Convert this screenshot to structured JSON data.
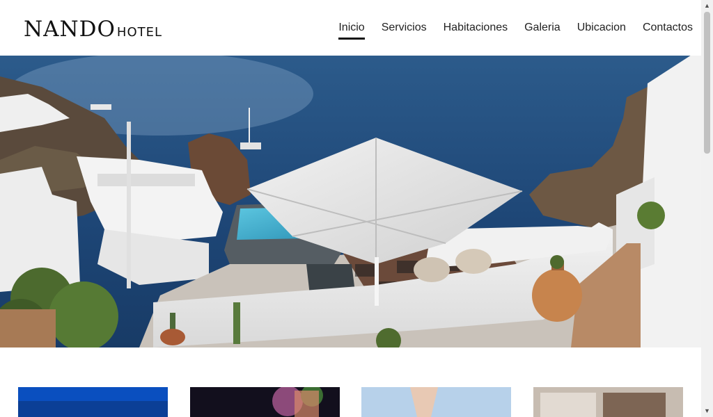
{
  "brand": {
    "name": "NANDO",
    "suffix": "HOTEL"
  },
  "nav": {
    "items": [
      {
        "label": "Inicio",
        "active": true
      },
      {
        "label": "Servicios"
      },
      {
        "label": "Habitaciones"
      },
      {
        "label": "Galeria"
      },
      {
        "label": "Ubicacion"
      },
      {
        "label": "Contactos"
      }
    ]
  },
  "colors": {
    "sea": "#1f4a7a",
    "pool": "#3aa9c9",
    "text": "#222222",
    "accent": "#111111"
  },
  "scrollbar": {
    "up_icon": "▲",
    "down_icon": "▼"
  }
}
